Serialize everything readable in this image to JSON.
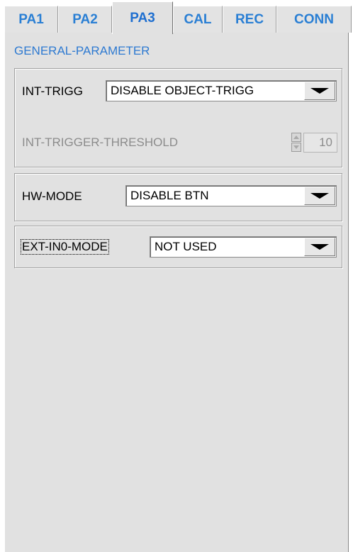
{
  "tabs": [
    {
      "label": "PA1",
      "active": false
    },
    {
      "label": "PA2",
      "active": false
    },
    {
      "label": "PA3",
      "active": true
    },
    {
      "label": "CAL",
      "active": false
    },
    {
      "label": "REC",
      "active": false
    },
    {
      "label": "CONN",
      "active": false
    }
  ],
  "section_label": "GENERAL-PARAMETER",
  "int_trigg": {
    "label": "INT-TRIGG",
    "value": "DISABLE OBJECT-TRIGG"
  },
  "int_trigger_threshold": {
    "label": "INT-TRIGGER-THRESHOLD",
    "value": "10",
    "enabled": false
  },
  "hw_mode": {
    "label": "HW-MODE",
    "value": "DISABLE BTN"
  },
  "ext_in0_mode": {
    "label": "EXT-IN0-MODE",
    "value": "NOT USED",
    "focused": true
  },
  "colors": {
    "tab_text": "#2a7fd4",
    "section_label": "#2e7ad1",
    "panel_bg": "#e1e1e1",
    "disabled_text": "#8c8c8c"
  }
}
